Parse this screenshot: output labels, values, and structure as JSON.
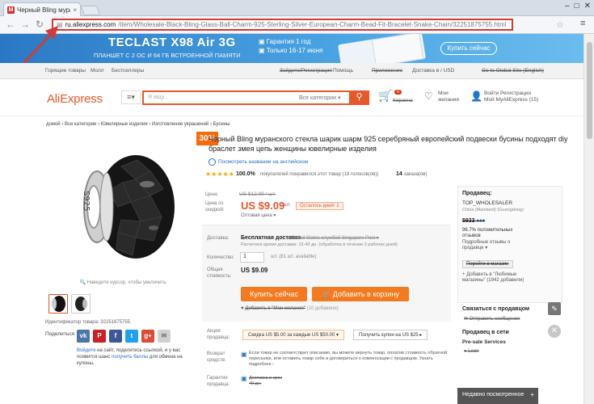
{
  "browser": {
    "tab_title": "Черный Bling мура",
    "tab_favicon": "M",
    "url_host": "ru.aliexpress.com",
    "url_path": "/item/Wholesale-Black-Bling-Glass-Ball-Charm-925-Sterling-Silver-European-Charm-Bead-Fit-Bracelet-Snake-Chain/32251875755.html",
    "icons": [
      "back-icon",
      "forward-icon",
      "reload-icon",
      "star-icon",
      "menu-icon"
    ]
  },
  "banner": {
    "brand": "TECLAST  X98 Air 3G",
    "subtitle": "ПЛАНШЕТ С 2 ОС И 64 ГБ ВСТРОЕННОЙ ПАМЯТИ",
    "guarantee": "Гарантия 1 год",
    "delivery": "Только 16-17 июня",
    "buy": "Купить сейчас"
  },
  "toplinks": [
    "Горящие товары",
    "Молл",
    "Бестселлеры",
    "Зайдите/Регистрация",
    "Помощь",
    "Приложение",
    "Доставка в  / USD",
    "Go to Global Site (English)"
  ],
  "header": {
    "logo": "AliExpress",
    "search_placeholder": "Я ищу...",
    "all_categories": "Все категории",
    "cart_count": "0",
    "cart_label": "Корзина",
    "wish_label": "Мои\nжелания",
    "acc_line1": "Войти  Регистрация",
    "acc_line2": "Мой MyAliExpress (15)"
  },
  "breadcrumb": "домой › Все категории › Ювелирные изделия › Изготовление украшений › Бусины",
  "product": {
    "discount_badge": "30%",
    "zoom_hint": "Наведите курсор, чтобы увеличить",
    "id_label": "Идентификатор товара: 32251875755",
    "share_label": "Поделиться",
    "share_text_1": "Войдите",
    "share_text_2": " на сайт, поделитесь ссылкой, и у вас появится шанс ",
    "share_text_3": "получить баллы",
    "share_text_4": " для обмена на купоны.",
    "title": "Черный Bling муранского стекла шарик шарм 925 серебряный европейский подвески бусины подходят diy браслет змея цепь женщины ювелирные изделия",
    "translate_link": "Посмотреть название на английском",
    "stars": "★★★★★",
    "positive_pct": "100.0%",
    "positive_text": "покупателей понравился этот товар (18 голосов(ов))",
    "orders_count": "14",
    "orders_label": "заказа(ов)",
    "price_label": "Цена:",
    "old_price": "US $12.99 / шт.",
    "discount_label": "Цена со\nскидкой:",
    "price": "US $9.09",
    "per_unit": "/ шт.",
    "days_left": "Осталось дней: 1",
    "wholesale": "Оптовая цена ▾",
    "shipping_label": "Доставка:",
    "shipping_free": "Бесплатная доставка",
    "shipping_via": "в United States службой Singapore Post ▾",
    "shipping_est": "Расчетное время доставки: 15-40 дн. (обработка в течение 3 рабочих дней)",
    "qty_label": "Количество:",
    "qty_value": "1",
    "qty_available": "шт. (81 шт. available)",
    "total_label": "Общая\nстоимость:",
    "total": "US $9.09",
    "buy_now": "Купить сейчас",
    "add_cart": "Добавить в корзину",
    "add_wish": "Добавить в \"Мои желания\"",
    "wish_count": "(10 добавили)",
    "promo_label": "Акция\nпродавца:",
    "promo1": "Скидка US $5.00 за каждые US $50.00 ▾",
    "promo2": "Получить купон на US $25 ▸",
    "return_label": "Возврат\nсредств:",
    "return_text": "Если товар не соответствует описанию, вы можете вернуть товар, оплатив стоимость обратной пересылки, или оставить товар себе и договориться о компенсации с продавцом. Узнать подробнее ›",
    "guarantee_label": "Гарантии\nпродавца:",
    "guarantee_text": "Доставка в срок\n40 дн."
  },
  "seller": {
    "label": "Продавец:",
    "name": "TOP_WHOLESALER",
    "location": "China (Mainland) (Guangdong)",
    "feedback": "5933",
    "pct": "96.7% положительных\nотзывов",
    "details": "Подробные отзывы о\nпродавце",
    "store": "Перейти в магазин",
    "favorite": "Добавить в \"Любимые\nмагазины\" (1942 добавили)",
    "contact": "Связаться с продавцом",
    "send_msg": "Отправить сообщение",
    "online": "Продавец в сети",
    "presale": "Pre-sale Services",
    "agent": "Leon"
  },
  "recent": {
    "label": "Недавно посмотренное",
    "close": "+"
  },
  "colors": {
    "accent": "#e8572a",
    "url_border": "#d23b36",
    "banner": "#2a78c4"
  }
}
